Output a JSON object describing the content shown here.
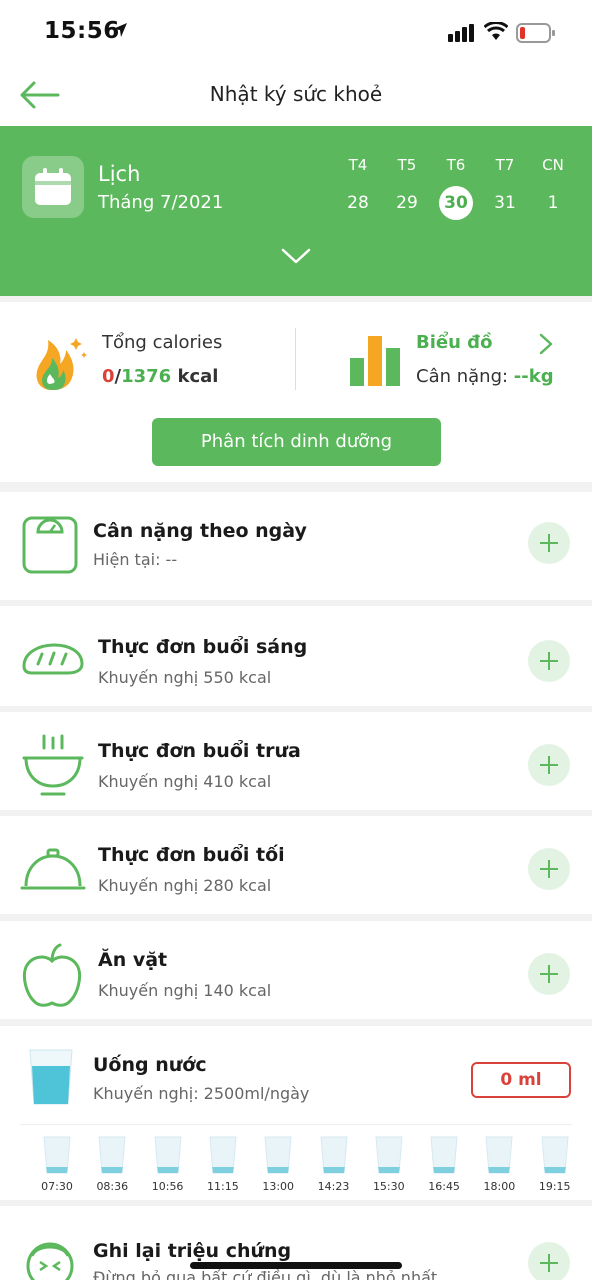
{
  "status": {
    "time": "15:56"
  },
  "nav": {
    "title": "Nhật ký sức khoẻ"
  },
  "calendar": {
    "title": "Lịch",
    "month": "Tháng 7/2021",
    "days": [
      {
        "name": "T4",
        "num": "28"
      },
      {
        "name": "T5",
        "num": "29"
      },
      {
        "name": "T6",
        "num": "30",
        "selected": true
      },
      {
        "name": "T7",
        "num": "31"
      },
      {
        "name": "CN",
        "num": "1"
      }
    ]
  },
  "summary": {
    "calories_label": "Tổng calories",
    "calories_consumed": "0",
    "calories_sep": "/",
    "calories_target": "1376",
    "calories_unit": " kcal",
    "chart_label": "Biểu đồ",
    "weight_label": "Cân nặng: ",
    "weight_value": "--kg",
    "analyze_button": "Phân tích dinh dưỡng"
  },
  "cards": {
    "weight": {
      "title": "Cân nặng theo ngày",
      "sub": "Hiện tại: --"
    },
    "breakfast": {
      "title": "Thực đơn buổi sáng",
      "sub": "Khuyến nghị 550 kcal"
    },
    "lunch": {
      "title": "Thực đơn buổi trưa",
      "sub": "Khuyến nghị 410 kcal"
    },
    "dinner": {
      "title": "Thực đơn buổi tối",
      "sub": "Khuyến nghị 280 kcal"
    },
    "snack": {
      "title": "Ăn vặt",
      "sub": "Khuyến nghị 140 kcal"
    },
    "water": {
      "title": "Uống nước",
      "sub": "Khuyến nghị: 2500ml/ngày",
      "amount": "0 ml",
      "times": [
        "07:30",
        "08:36",
        "10:56",
        "11:15",
        "13:00",
        "14:23",
        "15:30",
        "16:45",
        "18:00",
        "19:15"
      ]
    },
    "symptoms": {
      "title": "Ghi lại triệu chứng",
      "sub": "Đừng bỏ qua bất cứ điều gì, dù là nhỏ nhất"
    }
  },
  "colors": {
    "primary": "#5cb85c",
    "danger": "#d9423a"
  }
}
